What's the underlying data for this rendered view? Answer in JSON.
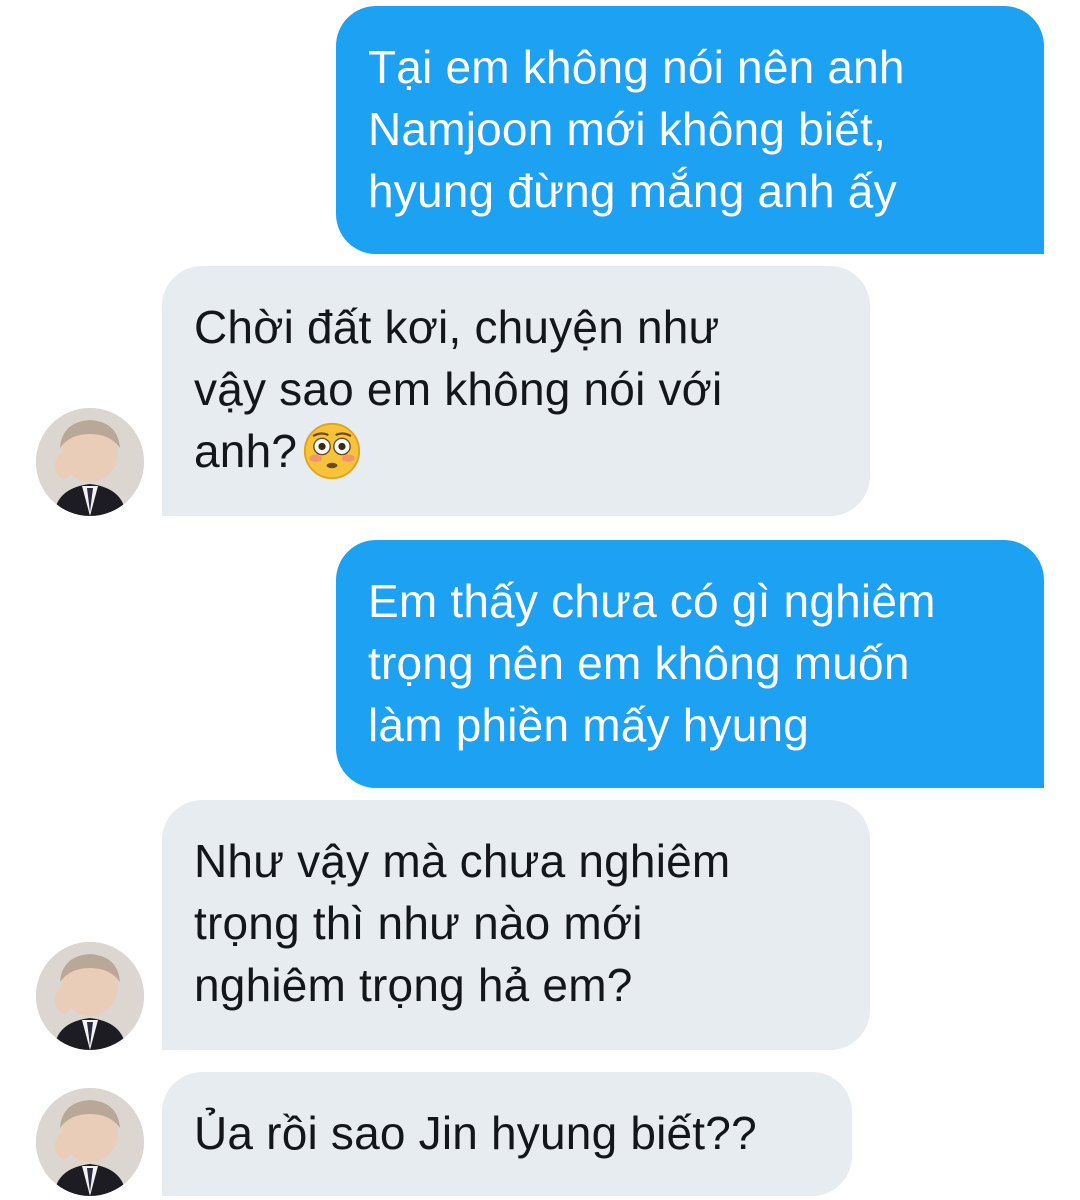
{
  "conversation": {
    "messages": [
      {
        "direction": "outgoing",
        "text": "Tại em không nói nên anh\nNamjoon mới không biết,\nhyung đừng mắng anh ấy"
      },
      {
        "direction": "incoming",
        "text": "Chời đất kơi, chuyện như\nvậy sao em không nói với\nanh?",
        "emoji": "flushed-face-icon"
      },
      {
        "direction": "outgoing",
        "text": "Em thấy chưa có gì nghiêm\ntrọng nên em không muốn\nlàm phiền mấy hyung"
      },
      {
        "direction": "incoming",
        "text": "Như vậy mà chưa nghiêm\ntrọng thì như nào mới\nnghiêm trọng hả em?"
      },
      {
        "direction": "incoming",
        "text": "Ủa rồi sao Jin hyung biết??"
      }
    ]
  },
  "colors": {
    "outgoing_bubble": "#1da1f2",
    "incoming_bubble": "#e6ecf0",
    "outgoing_text": "#ffffff",
    "incoming_text": "#14171a",
    "background": "#ffffff"
  },
  "icons": {
    "avatar": "user-avatar-photo",
    "emoji": "flushed-face-icon"
  }
}
